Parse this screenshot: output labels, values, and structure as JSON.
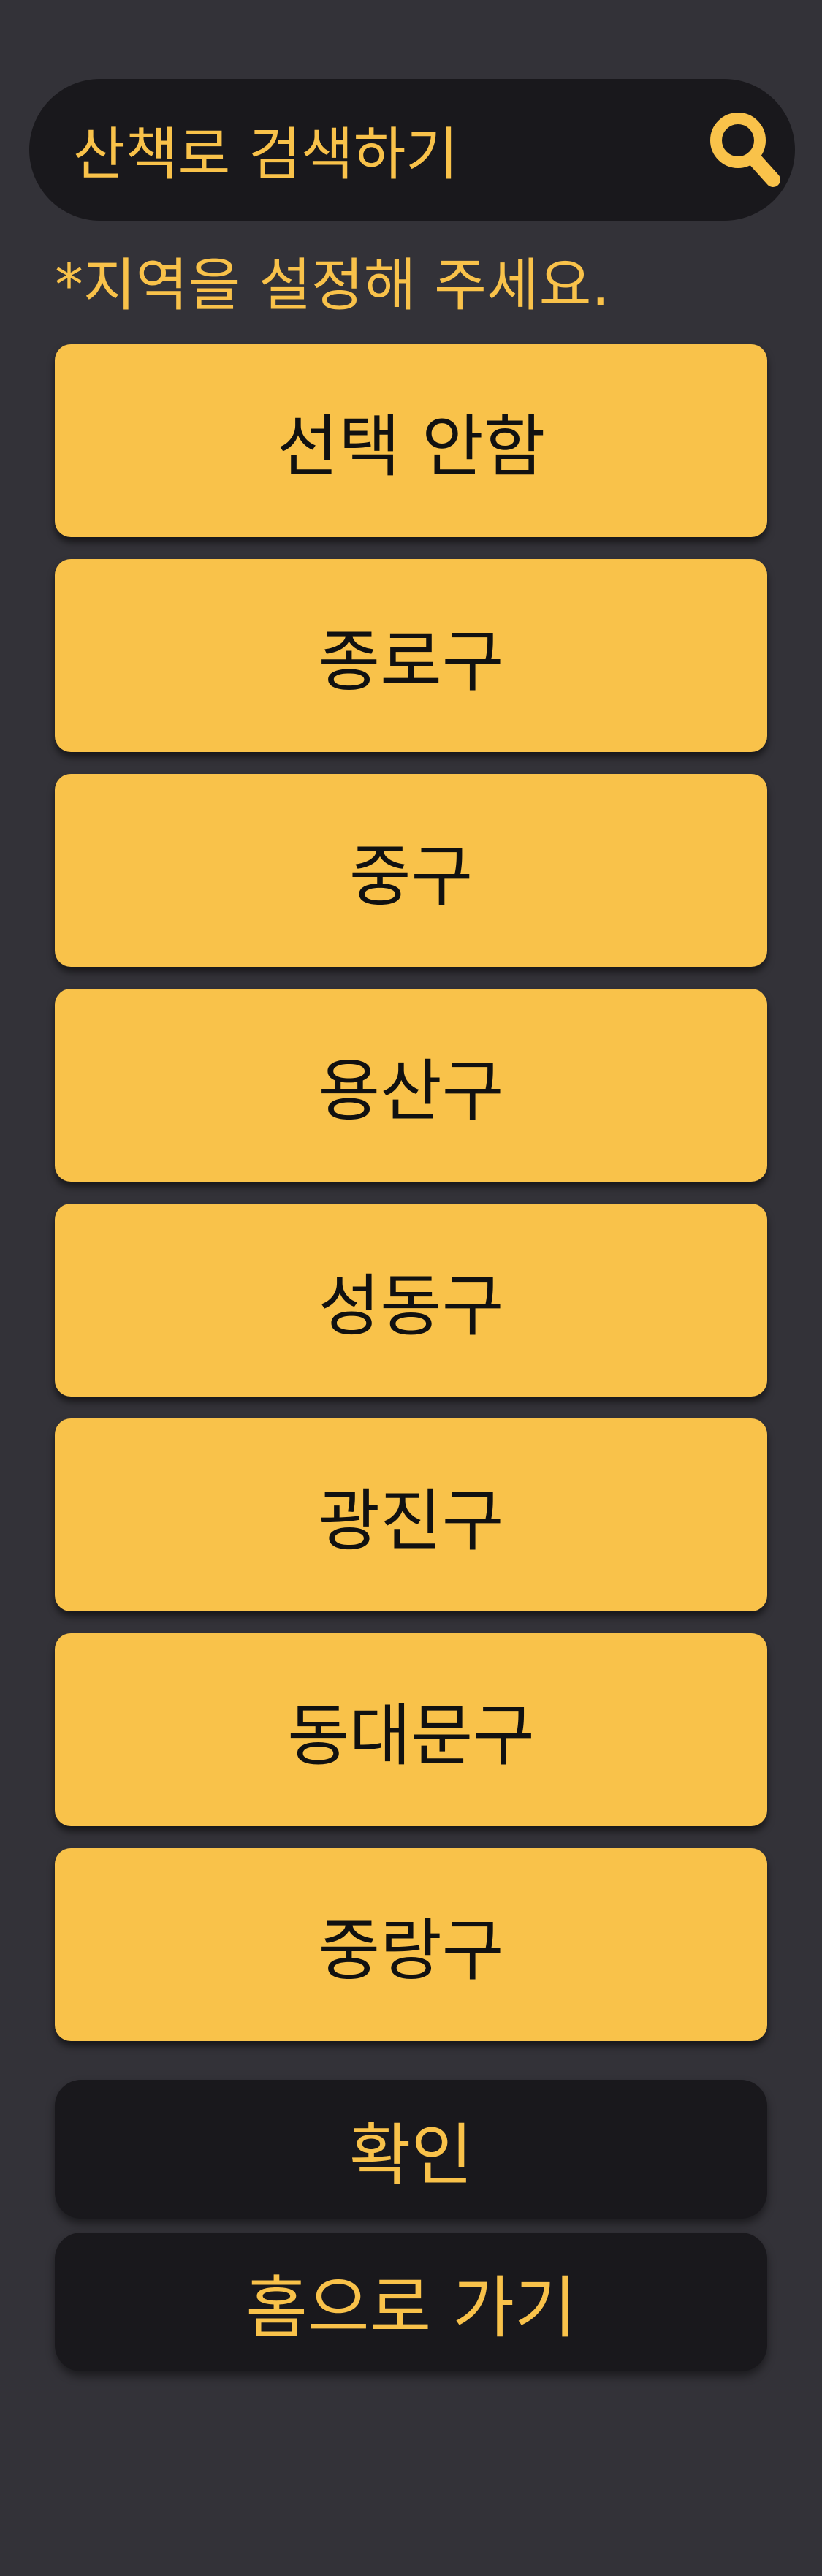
{
  "search": {
    "placeholder": "산책로 검색하기",
    "icon": "search-icon"
  },
  "hint": "*지역을 설정해 주세요.",
  "options": [
    "선택 안함",
    "종로구",
    "중구",
    "용산구",
    "성동구",
    "광진구",
    "동대문구",
    "중랑구"
  ],
  "actions": {
    "confirm_label": "확인",
    "home_label": "홈으로 가기"
  },
  "colors": {
    "background": "#333238",
    "accent": "#f9c24a",
    "dark": "#19181c",
    "option_text": "#111111"
  }
}
